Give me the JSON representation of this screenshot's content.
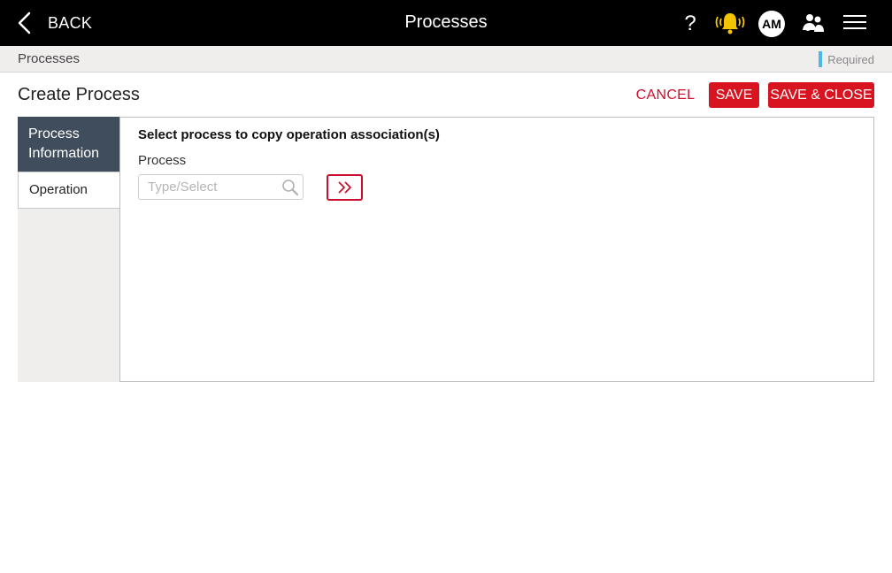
{
  "topbar": {
    "back_label": "BACK",
    "title": "Processes",
    "help_label": "?",
    "avatar_initials": "AM",
    "icons": [
      "chevron-left-icon",
      "help-icon",
      "bell-alert-icon",
      "team-icon",
      "hamburger-menu-icon"
    ]
  },
  "breadcrumb": {
    "label": "Processes",
    "required_label": "Required"
  },
  "page": {
    "title": "Create Process",
    "cancel_label": "CANCEL",
    "save_label": "SAVE",
    "save_close_label": "SAVE & CLOSE"
  },
  "side_nav": {
    "items": [
      {
        "label": "Process Information",
        "active": true
      },
      {
        "label": "Operation",
        "active": false
      }
    ]
  },
  "content": {
    "section_title": "Select process to copy operation association(s)",
    "process_label": "Process",
    "process_value": "",
    "process_placeholder": "Type/Select"
  },
  "colors": {
    "accent_red": "#d7141f",
    "nav_active": "#3f4d5c",
    "bell_yellow": "#f5c400",
    "required_blue": "#4db8e8"
  }
}
